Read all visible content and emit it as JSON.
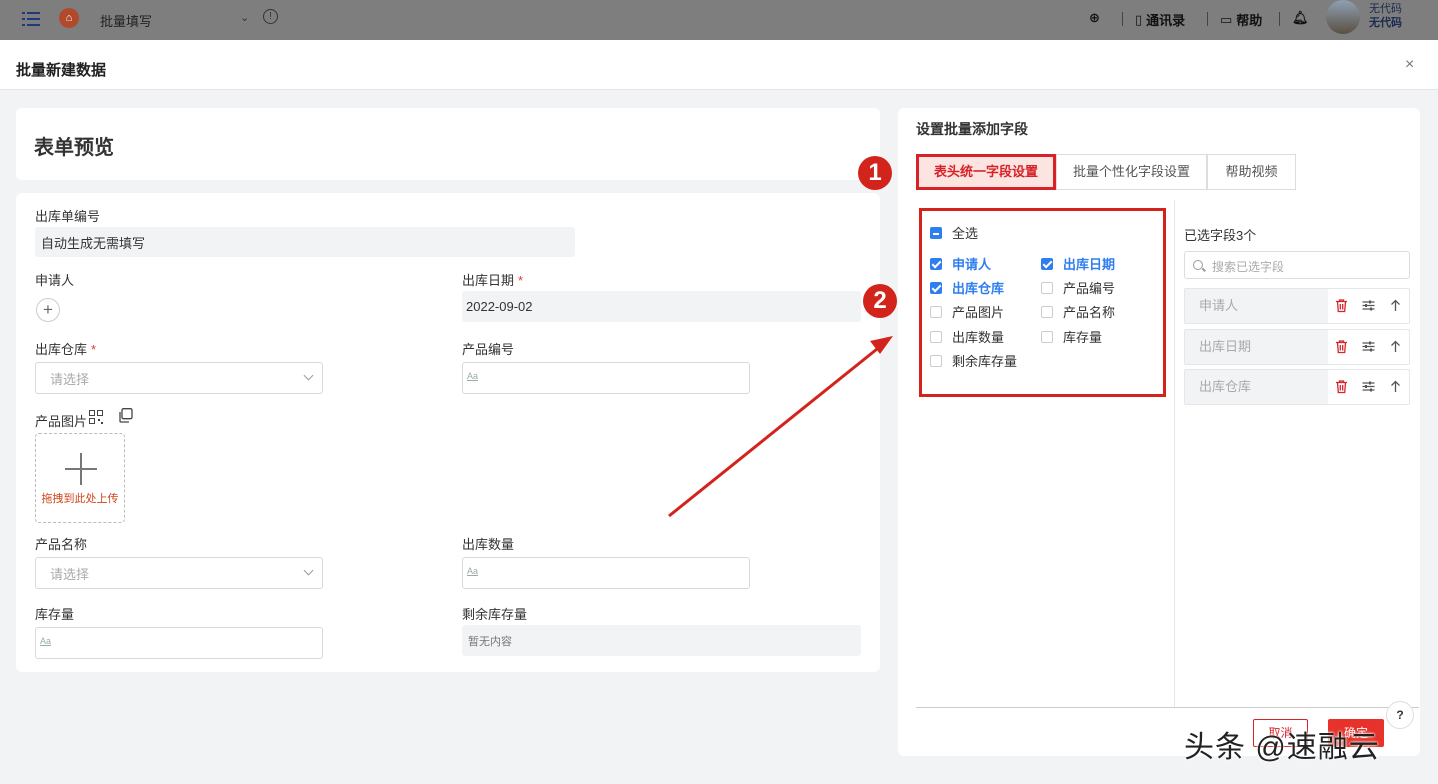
{
  "topbar": {
    "app_title": "批量填写",
    "contacts": "通讯录",
    "help": "帮助",
    "user_line1": "无代码",
    "user_line2": "无代码"
  },
  "modal": {
    "title": "批量新建数据",
    "close": "×"
  },
  "preview": {
    "title": "表单预览",
    "fields": {
      "order_no_label": "出库单编号",
      "order_no_value": "自动生成无需填写",
      "applicant_label": "申请人",
      "date_label": "出库日期",
      "date_value": "2022-09-02",
      "warehouse_label": "出库仓库",
      "warehouse_placeholder": "请选择",
      "product_code_label": "产品编号",
      "text_hint": "Aa",
      "image_label": "产品图片",
      "upload_text": "拖拽到此处上传",
      "product_name_label": "产品名称",
      "product_name_placeholder": "请选择",
      "qty_label": "出库数量",
      "stock_label": "库存量",
      "remaining_label": "剩余库存量",
      "remaining_value": "暂无内容",
      "required_mark": "*"
    }
  },
  "panel": {
    "title": "设置批量添加字段",
    "tabs": [
      "表头统一字段设置",
      "批量个性化字段设置",
      "帮助视频"
    ],
    "badge1": "1",
    "badge2": "2",
    "select_all": "全选",
    "checkboxes": [
      {
        "label": "申请人",
        "checked": true
      },
      {
        "label": "出库日期",
        "checked": true
      },
      {
        "label": "出库仓库",
        "checked": true
      },
      {
        "label": "产品编号",
        "checked": false
      },
      {
        "label": "产品图片",
        "checked": false
      },
      {
        "label": "产品名称",
        "checked": false
      },
      {
        "label": "出库数量",
        "checked": false
      },
      {
        "label": "库存量",
        "checked": false
      },
      {
        "label": "剩余库存量",
        "checked": false
      }
    ],
    "selected_count": "已选字段3个",
    "search_placeholder": "搜索已选字段",
    "selected_items": [
      "申请人",
      "出库日期",
      "出库仓库"
    ],
    "help_mark": "?",
    "cancel": "取消",
    "confirm": "确定"
  },
  "watermark": "头条 @速融云",
  "colors": {
    "accent_red": "#d6232a",
    "checkbox_blue": "#2f7ef0"
  }
}
